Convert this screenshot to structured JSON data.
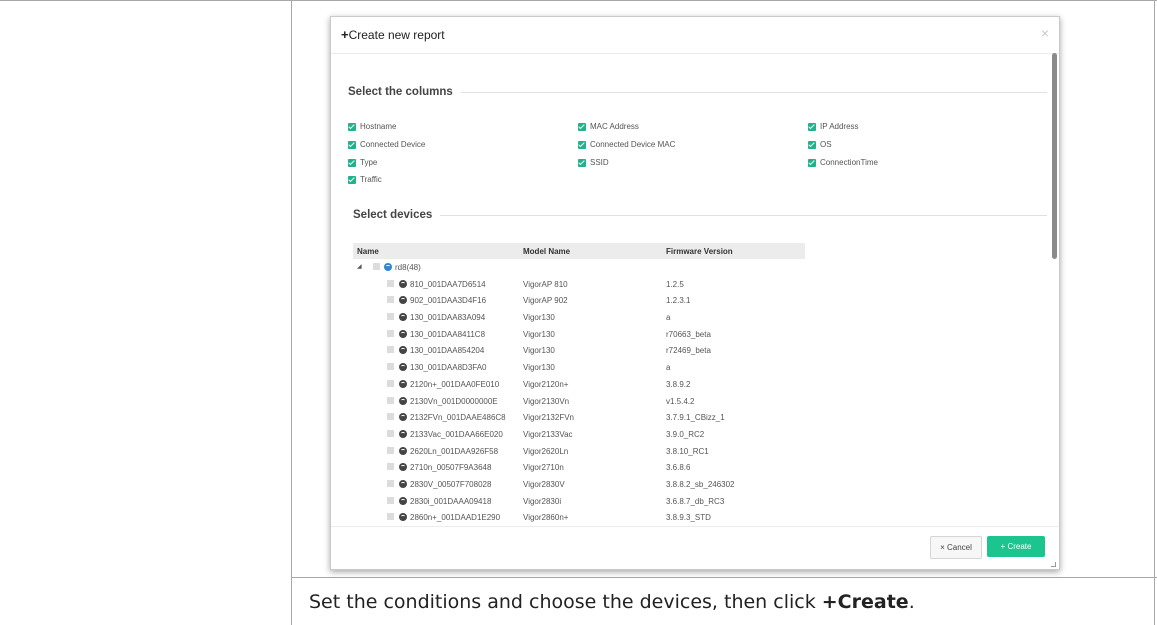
{
  "dialog": {
    "title_plus": "+",
    "title": "Create new report",
    "close_glyph": "×"
  },
  "columns_section": {
    "title": "Select the columns",
    "options": [
      {
        "label": "Hostname",
        "checked": true
      },
      {
        "label": "MAC Address",
        "checked": true
      },
      {
        "label": "IP Address",
        "checked": true
      },
      {
        "label": "Connected Device",
        "checked": true
      },
      {
        "label": "Connected Device MAC",
        "checked": true
      },
      {
        "label": "OS",
        "checked": true
      },
      {
        "label": "Type",
        "checked": true
      },
      {
        "label": "SSID",
        "checked": true
      },
      {
        "label": "ConnectionTime",
        "checked": true
      },
      {
        "label": "Traffic",
        "checked": true
      }
    ]
  },
  "devices_section": {
    "title": "Select devices",
    "headers": {
      "name": "Name",
      "model": "Model Name",
      "firmware": "Firmware Version"
    },
    "root": {
      "expand_glyph": "◢",
      "label": "rd8(48)"
    },
    "rows": [
      {
        "name": "810_001DAA7D6514",
        "model": "VigorAP 810",
        "firmware": "1.2.5"
      },
      {
        "name": "902_001DAA3D4F16",
        "model": "VigorAP 902",
        "firmware": "1.2.3.1"
      },
      {
        "name": "130_001DAA83A094",
        "model": "Vigor130",
        "firmware": "a"
      },
      {
        "name": "130_001DAA8411C8",
        "model": "Vigor130",
        "firmware": "r70663_beta"
      },
      {
        "name": "130_001DAA854204",
        "model": "Vigor130",
        "firmware": "r72469_beta"
      },
      {
        "name": "130_001DAA8D3FA0",
        "model": "Vigor130",
        "firmware": "a"
      },
      {
        "name": "2120n+_001DAA0FE010",
        "model": "Vigor2120n+",
        "firmware": "3.8.9.2"
      },
      {
        "name": "2130Vn_001D0000000E",
        "model": "Vigor2130Vn",
        "firmware": "v1.5.4.2"
      },
      {
        "name": "2132FVn_001DAAE486C8",
        "model": "Vigor2132FVn",
        "firmware": "3.7.9.1_CBizz_1"
      },
      {
        "name": "2133Vac_001DAA66E020",
        "model": "Vigor2133Vac",
        "firmware": "3.9.0_RC2"
      },
      {
        "name": "2620Ln_001DAA926F58",
        "model": "Vigor2620Ln",
        "firmware": "3.8.10_RC1"
      },
      {
        "name": "2710n_00507F9A3648",
        "model": "Vigor2710n",
        "firmware": "3.6.8.6"
      },
      {
        "name": "2830V_00507F708028",
        "model": "Vigor2830V",
        "firmware": "3.8.8.2_sb_246302"
      },
      {
        "name": "2830i_001DAAA09418",
        "model": "Vigor2830i",
        "firmware": "3.6.8.7_db_RC3"
      },
      {
        "name": "2860n+_001DAAD1E290",
        "model": "Vigor2860n+",
        "firmware": "3.8.9.3_STD"
      }
    ]
  },
  "footer": {
    "cancel_label": "× Cancel",
    "create_label": "+  Create"
  },
  "caption": {
    "text": "Set the conditions and choose the devices, then click ",
    "emphasis": "+Create",
    "end": "."
  },
  "colors": {
    "accent": "#1bc58d",
    "checkbox": "#20b28a",
    "root_icon": "#2f86d4"
  },
  "icons": [
    "close-icon",
    "checkbox-checked-icon",
    "tree-expand-icon",
    "network-group-icon",
    "device-icon",
    "resize-grip-icon"
  ]
}
